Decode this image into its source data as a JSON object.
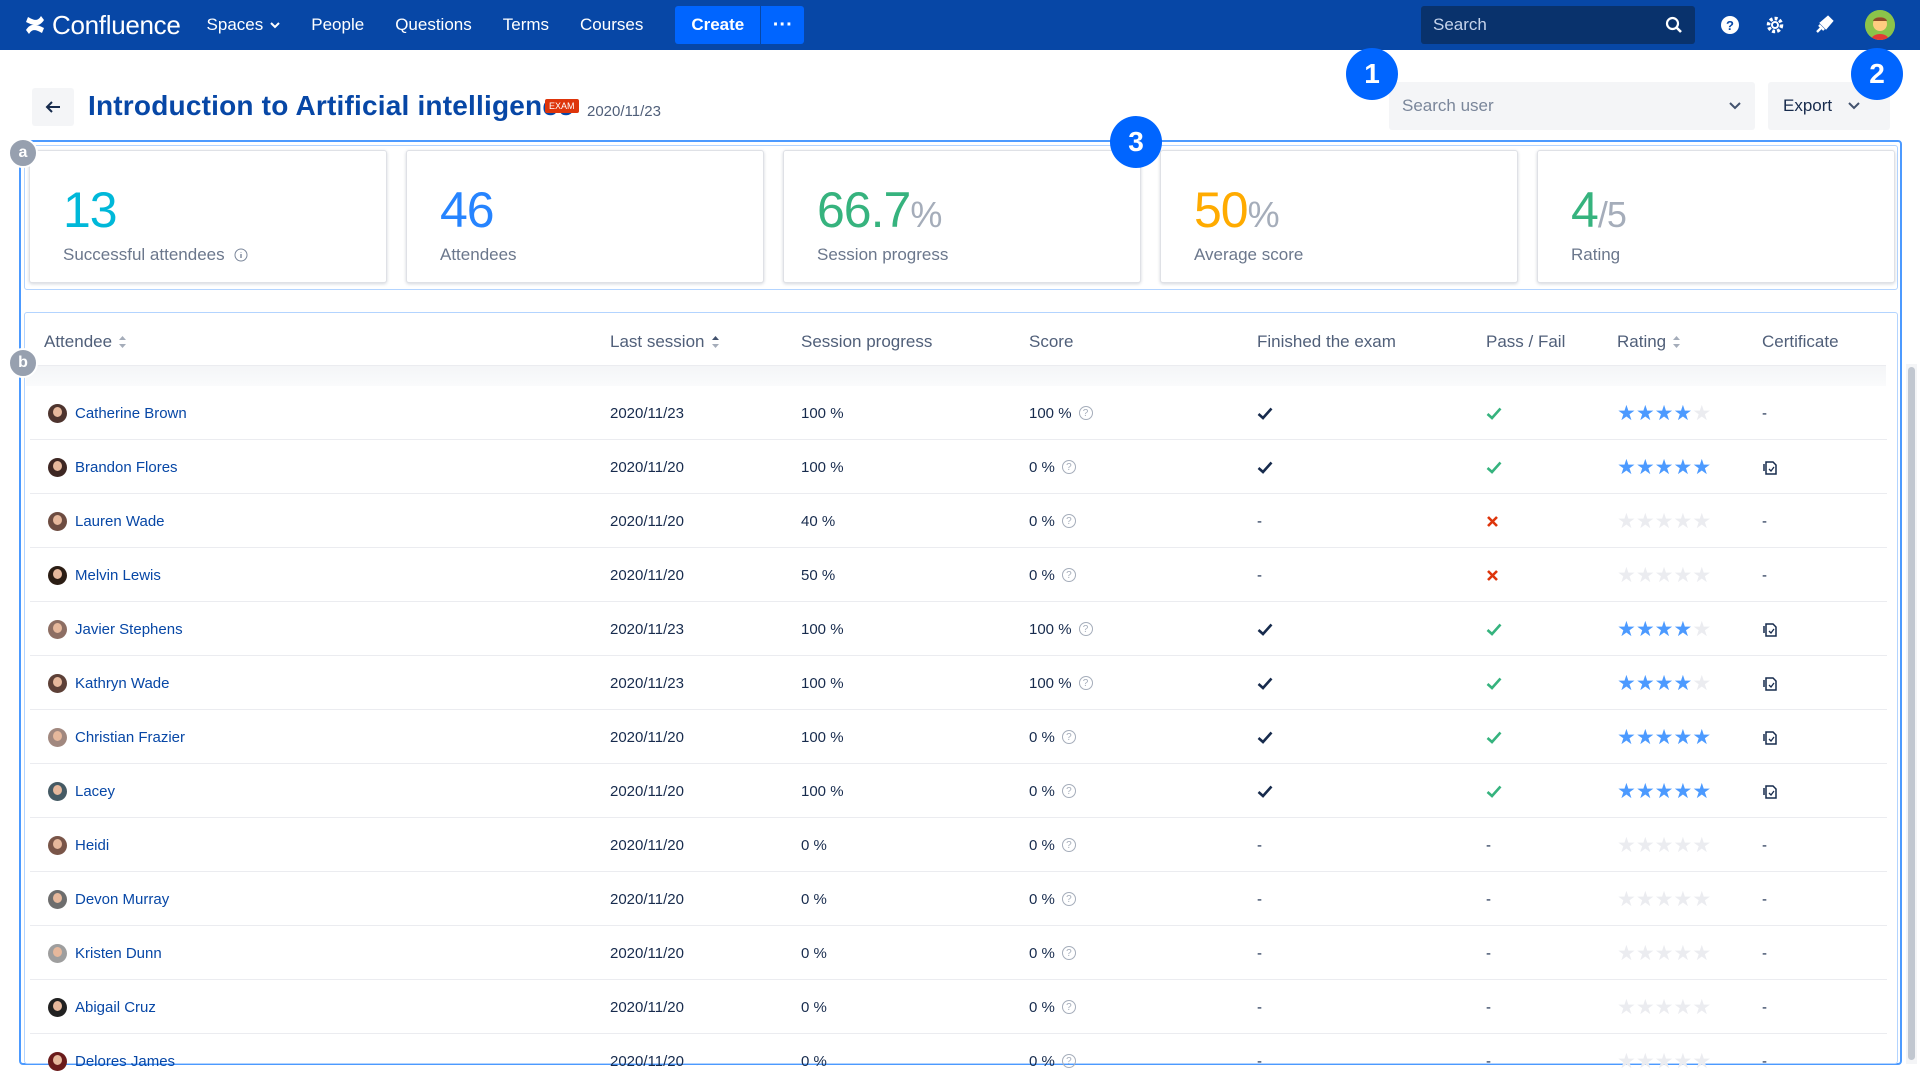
{
  "app": {
    "name": "Confluence",
    "nav": [
      "Spaces",
      "People",
      "Questions",
      "Terms",
      "Courses"
    ],
    "create_label": "Create",
    "more_label": "···",
    "search_placeholder": "Search"
  },
  "header": {
    "title": "Introduction to Artificial intelligence",
    "badge": "EXAM",
    "date": "2020/11/23",
    "search_user_placeholder": "Search user",
    "export_label": "Export"
  },
  "callouts": [
    "1",
    "2",
    "3"
  ],
  "mini_callouts": [
    "a",
    "b"
  ],
  "stats": [
    {
      "value": "13",
      "suffix": "",
      "label": "Successful attendees",
      "color": "#00b8d9"
    },
    {
      "value": "46",
      "suffix": "",
      "label": "Attendees",
      "color": "#2684ff"
    },
    {
      "value": "66.7",
      "suffix": "%",
      "label": "Session progress",
      "color": "#36b37e"
    },
    {
      "value": "50",
      "suffix": "%",
      "label": "Average score",
      "color": "#ffab00"
    },
    {
      "value": "4",
      "suffix": "/5",
      "label": "Rating",
      "color": "#36b37e"
    }
  ],
  "table": {
    "columns": [
      "Attendee",
      "Last session",
      "Session progress",
      "Score",
      "Finished the exam",
      "Pass / Fail",
      "Rating",
      "Certificate"
    ],
    "rows": [
      {
        "name": "Catherine Brown",
        "last": "2020/11/23",
        "progress": "100 %",
        "score": "100 %",
        "finished": true,
        "pass": "pass",
        "rating": 4,
        "cert": false
      },
      {
        "name": "Brandon Flores",
        "last": "2020/11/20",
        "progress": "100 %",
        "score": "0 %",
        "finished": true,
        "pass": "pass",
        "rating": 5,
        "cert": true
      },
      {
        "name": "Lauren Wade",
        "last": "2020/11/20",
        "progress": "40 %",
        "score": "0 %",
        "finished": false,
        "pass": "fail",
        "rating": 0,
        "cert": false
      },
      {
        "name": "Melvin Lewis",
        "last": "2020/11/20",
        "progress": "50 %",
        "score": "0 %",
        "finished": false,
        "pass": "fail",
        "rating": 0,
        "cert": false
      },
      {
        "name": "Javier Stephens",
        "last": "2020/11/23",
        "progress": "100 %",
        "score": "100 %",
        "finished": true,
        "pass": "pass",
        "rating": 4,
        "cert": true
      },
      {
        "name": "Kathryn Wade",
        "last": "2020/11/23",
        "progress": "100 %",
        "score": "100 %",
        "finished": true,
        "pass": "pass",
        "rating": 4,
        "cert": true
      },
      {
        "name": "Christian Frazier",
        "last": "2020/11/20",
        "progress": "100 %",
        "score": "0 %",
        "finished": true,
        "pass": "pass",
        "rating": 5,
        "cert": true
      },
      {
        "name": "Lacey",
        "last": "2020/11/20",
        "progress": "100 %",
        "score": "0 %",
        "finished": true,
        "pass": "pass",
        "rating": 5,
        "cert": true
      },
      {
        "name": "Heidi",
        "last": "2020/11/20",
        "progress": "0 %",
        "score": "0 %",
        "finished": false,
        "pass": "none",
        "rating": 0,
        "cert": false
      },
      {
        "name": "Devon Murray",
        "last": "2020/11/20",
        "progress": "0 %",
        "score": "0 %",
        "finished": false,
        "pass": "none",
        "rating": 0,
        "cert": false
      },
      {
        "name": "Kristen Dunn",
        "last": "2020/11/20",
        "progress": "0 %",
        "score": "0 %",
        "finished": false,
        "pass": "none",
        "rating": 0,
        "cert": false
      },
      {
        "name": "Abigail Cruz",
        "last": "2020/11/20",
        "progress": "0 %",
        "score": "0 %",
        "finished": false,
        "pass": "none",
        "rating": 0,
        "cert": false
      },
      {
        "name": "Delores James",
        "last": "2020/11/20",
        "progress": "0 %",
        "score": "0 %",
        "finished": false,
        "pass": "none",
        "rating": 0,
        "cert": false
      }
    ]
  },
  "icons": {
    "check": "check-icon",
    "cross": "cross-icon",
    "dash": "-",
    "star_filled_color": "#4c9aff",
    "star_empty_color": "#ebecf0",
    "pass_color": "#36b37e",
    "fail_color": "#de350b"
  }
}
